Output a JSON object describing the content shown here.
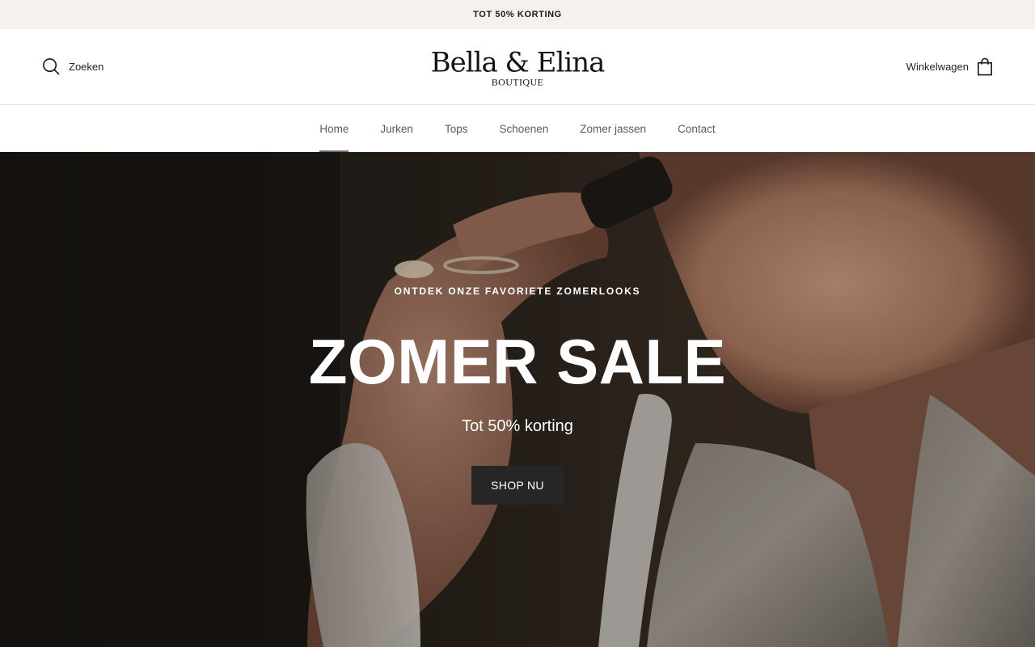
{
  "announcement": {
    "text": "TOT 50% KORTING"
  },
  "header": {
    "search_label": "Zoeken",
    "logo": {
      "name": "Bella & Elina",
      "sub": "BOUTIQUE"
    },
    "cart_label": "Winkelwagen"
  },
  "nav": {
    "items": [
      {
        "label": "Home",
        "active": true
      },
      {
        "label": "Jurken"
      },
      {
        "label": "Tops"
      },
      {
        "label": "Schoenen"
      },
      {
        "label": "Zomer jassen"
      },
      {
        "label": "Contact"
      }
    ]
  },
  "hero": {
    "kicker": "ONTDEK ONZE FAVORIETE ZOMERLOOKS",
    "title": "ZOMER SALE",
    "subtitle": "Tot 50% korting",
    "button": "SHOP NU"
  },
  "colors": {
    "announcement_bg": "#f5f2ee",
    "button_bg": "#262626",
    "hero_bg": "#231d17"
  }
}
